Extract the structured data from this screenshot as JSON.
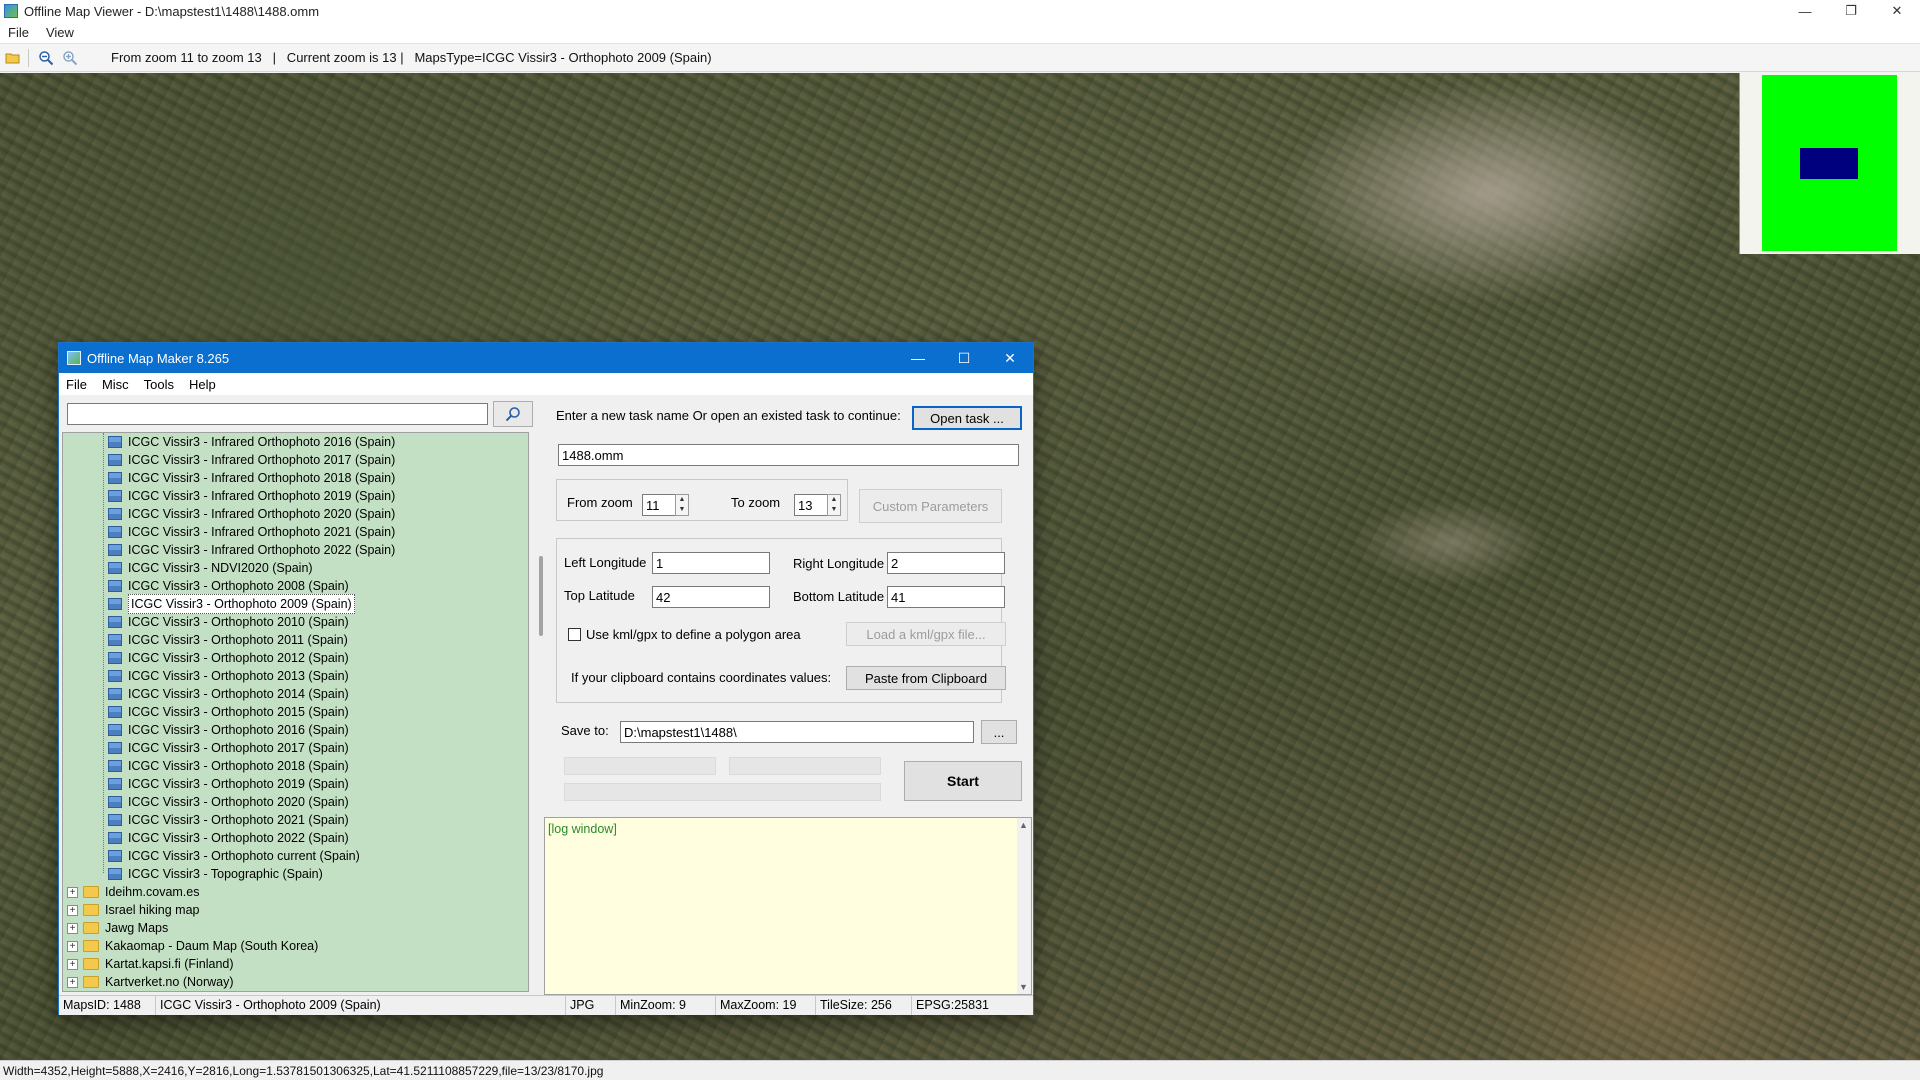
{
  "window": {
    "title": "Offline Map Viewer - D:\\mapstest1\\1488\\1488.omm",
    "controls": {
      "minimize": "—",
      "maximize": "❐",
      "close": "✕"
    }
  },
  "menu": {
    "file": "File",
    "view": "View"
  },
  "toolbar": {
    "status_text": "From zoom 11 to zoom 13   |   Current zoom is 13 |   MapsType=ICGC Vissir3 - Orthophoto 2009 (Spain)"
  },
  "overview": {
    "bg_color": "#00ff00",
    "viewport_color": "#00007f"
  },
  "statusbar": {
    "text": "Width=4352,Height=5888,X=2416,Y=2816,Long=1.53781501306325,Lat=41.5211108857229,file=13/23/8170.jpg"
  },
  "dialog": {
    "title": "Offline Map Maker 8.265",
    "controls": {
      "minimize": "—",
      "maximize": "☐",
      "close": "✕"
    },
    "menu": {
      "file": "File",
      "misc": "Misc",
      "tools": "Tools",
      "help": "Help"
    },
    "search": {
      "value": ""
    },
    "tree": {
      "map_items": [
        "ICGC Vissir3 - Infrared Orthophoto 2016 (Spain)",
        "ICGC Vissir3 - Infrared Orthophoto 2017 (Spain)",
        "ICGC Vissir3 - Infrared Orthophoto 2018 (Spain)",
        "ICGC Vissir3 - Infrared Orthophoto 2019 (Spain)",
        "ICGC Vissir3 - Infrared Orthophoto 2020 (Spain)",
        "ICGC Vissir3 - Infrared Orthophoto 2021 (Spain)",
        "ICGC Vissir3 - Infrared Orthophoto 2022 (Spain)",
        "ICGC Vissir3 - NDVI2020 (Spain)",
        "ICGC Vissir3 - Orthophoto 2008 (Spain)",
        "ICGC Vissir3 - Orthophoto 2009 (Spain)",
        "ICGC Vissir3 - Orthophoto 2010 (Spain)",
        "ICGC Vissir3 - Orthophoto 2011 (Spain)",
        "ICGC Vissir3 - Orthophoto 2012 (Spain)",
        "ICGC Vissir3 - Orthophoto 2013 (Spain)",
        "ICGC Vissir3 - Orthophoto 2014 (Spain)",
        "ICGC Vissir3 - Orthophoto 2015 (Spain)",
        "ICGC Vissir3 - Orthophoto 2016 (Spain)",
        "ICGC Vissir3 - Orthophoto 2017 (Spain)",
        "ICGC Vissir3 - Orthophoto 2018 (Spain)",
        "ICGC Vissir3 - Orthophoto 2019 (Spain)",
        "ICGC Vissir3 - Orthophoto 2020 (Spain)",
        "ICGC Vissir3 - Orthophoto 2021 (Spain)",
        "ICGC Vissir3 - Orthophoto 2022 (Spain)",
        "ICGC Vissir3 - Orthophoto current (Spain)",
        "ICGC Vissir3 - Topographic (Spain)"
      ],
      "selected_index": 9,
      "folders": [
        "Ideihm.covam.es",
        "Israel hiking map",
        "Jawg Maps",
        "Kakaomap - Daum Map (South Korea)",
        "Kartat.kapsi.fi (Finland)",
        "Kartverket.no (Norway)"
      ]
    },
    "task": {
      "prompt": "Enter a new task name Or open an existed task to continue:",
      "open_button": "Open task ...",
      "name_value": "1488.omm"
    },
    "zoom": {
      "from_label": "From zoom",
      "from_value": "11",
      "to_label": "To zoom",
      "to_value": "13",
      "custom_params_button": "Custom Parameters"
    },
    "coords": {
      "left_lon_label": "Left Longitude",
      "left_lon_value": "1",
      "right_lon_label": "Right Longitude",
      "right_lon_value": "2",
      "top_lat_label": "Top Latitude",
      "top_lat_value": "42",
      "bottom_lat_label": "Bottom Latitude",
      "bottom_lat_value": "41",
      "kml_checkbox_label": "Use kml/gpx to define a polygon area",
      "kml_checked": false,
      "load_kml_button": "Load a kml/gpx file...",
      "clipboard_label": "If your clipboard contains coordinates values:",
      "paste_button": "Paste from Clipboard"
    },
    "save": {
      "label": "Save to:",
      "path_value": "D:\\mapstest1\\1488\\",
      "browse_button": "...",
      "start_button": "Start"
    },
    "log": {
      "text": "[log window]"
    },
    "status": {
      "maps_id": "MapsID: 1488",
      "map_type": "ICGC Vissir3 - Orthophoto 2009 (Spain)",
      "format": "JPG",
      "min_zoom": "MinZoom: 9",
      "max_zoom": "MaxZoom: 19",
      "tile_size": "TileSize: 256",
      "epsg": "EPSG:25831"
    }
  }
}
